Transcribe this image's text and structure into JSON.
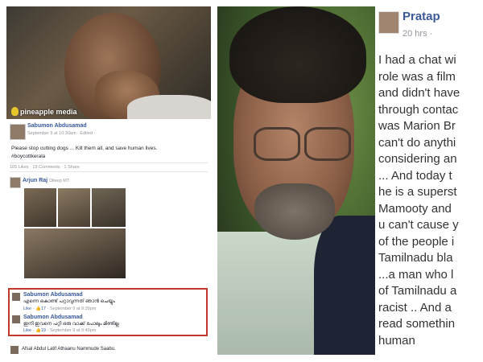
{
  "left": {
    "brand": "pineapple media",
    "post": {
      "author": "Sabumon Abdusamad",
      "meta": "September 9 at 10:30am · Edited ·",
      "text_line1": "Please stop cutting dogs ... Kill them all, and save human lives.",
      "text_line2": "#boycottkerala",
      "stats": "165 Likes · 19 Comments · 1 Share"
    },
    "share": {
      "author": "Arjun Raj",
      "author_suffix": "Dileep MT"
    },
    "comments": [
      {
        "author": "Sabumon Abdusamad",
        "text": "എന്നെ കൊണ്ട് പറ്റാവുന്നത് ഞാൻ ചെയ്യും",
        "like": "Like",
        "likes": "17",
        "time": "September 9 at 9:39pm"
      },
      {
        "author": "Sabumon Abdusamad",
        "text": "ഇനി ഇവനെ പറ്റി ഒരു വാക്ക് പോലും മിണ്ടില്ല",
        "like": "Like",
        "likes": "19",
        "time": "September 9 at 9:40pm"
      }
    ],
    "last_comment": "Afsal Abdul Latif Athaanu Nammude Saabu."
  },
  "right": {
    "name": "Pratap",
    "time": "20 hrs ·",
    "lines": [
      "I had a chat wi",
      "role was a film",
      "and didn't have",
      "through contac",
      "was Marion Br",
      "can't do anythi",
      "considering an",
      "... And today t",
      "he is a superst",
      "Mamooty and",
      "u can't cause y",
      "of the people i",
      "Tamilnadu bla",
      "...a man who l",
      "of Tamilnadu a",
      "racist .. And a",
      "read somethin",
      "human"
    ]
  }
}
